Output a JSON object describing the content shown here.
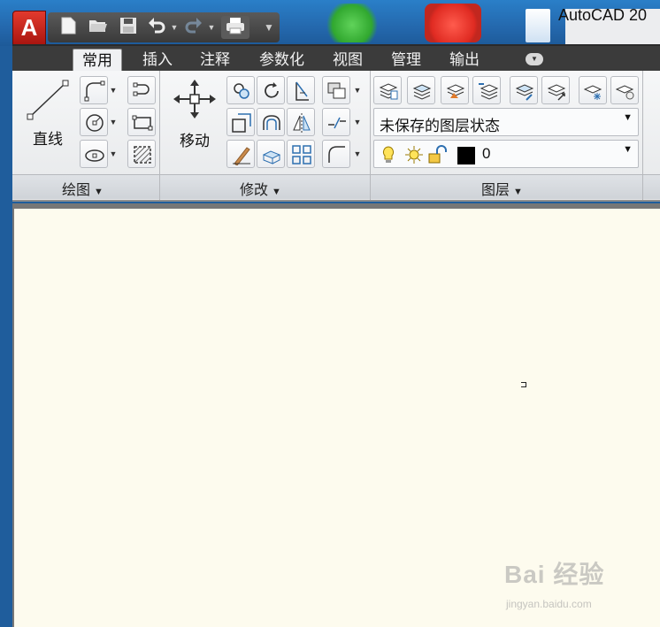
{
  "window": {
    "title": "AutoCAD 20",
    "app_logo": "A"
  },
  "qat": {
    "icons": [
      "new-icon",
      "open-icon",
      "save-icon",
      "undo-icon",
      "redo-icon",
      "print-icon",
      "qat-menu-icon"
    ]
  },
  "tabs": [
    {
      "label": "常用",
      "active": true
    },
    {
      "label": "插入"
    },
    {
      "label": "注释"
    },
    {
      "label": "参数化"
    },
    {
      "label": "视图"
    },
    {
      "label": "管理"
    },
    {
      "label": "输出"
    }
  ],
  "panels": {
    "draw": {
      "title": "绘图",
      "line_label": "直线"
    },
    "modify": {
      "title": "修改",
      "move_label": "移动"
    },
    "layers": {
      "title": "图层",
      "layer_state": "未保存的图层状态",
      "current_layer": "0",
      "current_layer_color": "#000000"
    }
  },
  "watermark": {
    "text": "Bai 经验",
    "sub": "jingyan.baidu.com"
  },
  "colors": {
    "canvas": "#fdfbee",
    "ribbon": "#eceef1",
    "tabbar": "#3b3b3b",
    "app_button": "#d1281f"
  }
}
